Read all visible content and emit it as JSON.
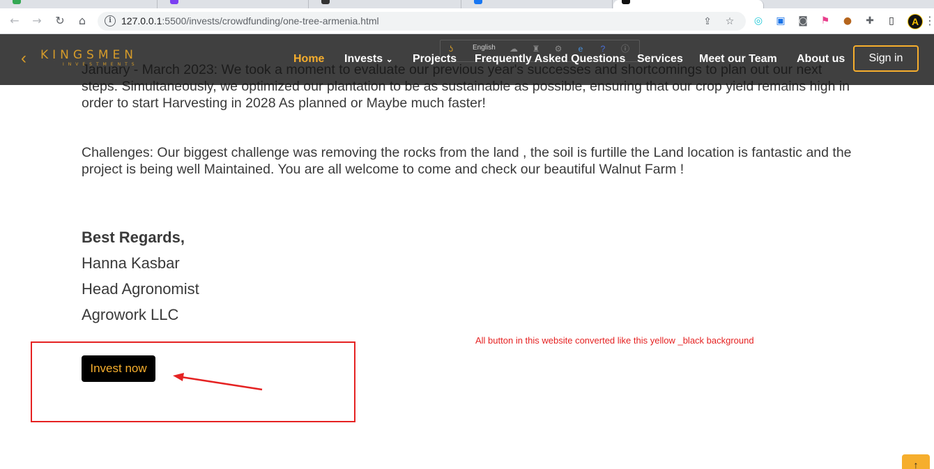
{
  "browser": {
    "url_host": "127.0.0.1",
    "url_path": ":5500/invests/crowdfunding/one-tree-armenia.html",
    "profile_initial": "A"
  },
  "site": {
    "logo_text": "KINGSMEN",
    "logo_sub": "INVESTMENTS",
    "nav": {
      "home": "Home",
      "invests": "Invests",
      "projects": "Projects",
      "faq": "Frequently Asked Questions",
      "services": "Services",
      "team": "Meet our Team",
      "about": "About us",
      "signin": "Sign in"
    },
    "translate": {
      "language": "English"
    }
  },
  "content": {
    "para_top": "January - March 2023: We took a moment to evaluate our previous year's successes and shortcomings to plan out our next steps. Simultaneously, we optimized our plantation to be as sustainable as possible, ensuring that our crop yield remains high in order to start Harvesting in 2028 As planned or Maybe much faster!",
    "para_challenges": "Challenges: Our biggest challenge was removing the rocks from the land , the soil is furtille the Land location is fantastic and the project is being well Maintained. You are all welcome to come and check our beautiful Walnut Farm !",
    "regards": "Best Regards,",
    "name": "Hanna Kasbar",
    "title": "Head Agronomist",
    "company": "Agrowork LLC",
    "invest_button": "Invest now"
  },
  "annotation": {
    "note": "All button in this website converted like this yellow _black background",
    "color": "#e52222"
  },
  "colors": {
    "accent": "#f6ae2d",
    "button_bg": "#000000",
    "nav_bg": "#161616"
  }
}
